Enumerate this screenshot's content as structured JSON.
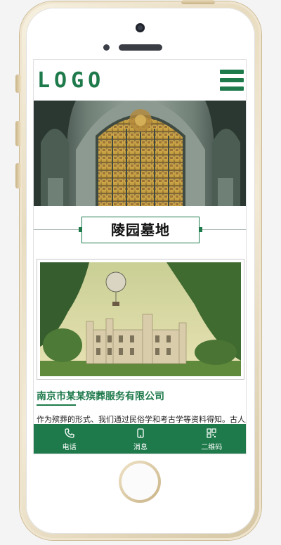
{
  "header": {
    "logo_text": "LOGO",
    "menu_icon": "hamburger-icon"
  },
  "banner": {
    "description": "cathedral-interior-image"
  },
  "section": {
    "title": "陵园墓地"
  },
  "feature": {
    "image": "castle-landscape-painting"
  },
  "company": {
    "name": "南京市某某殡葬服务有限公司",
    "description": "作为殡葬的形式、我们通过民俗学和考古学等资料得知。古人从"
  },
  "bottom_nav": {
    "items": [
      {
        "label": "电话",
        "icon": "phone-icon"
      },
      {
        "label": "消息",
        "icon": "message-icon"
      },
      {
        "label": "二维码",
        "icon": "qrcode-icon"
      }
    ]
  },
  "colors": {
    "brand": "#1e7a4b",
    "frame": "#e8dcc0"
  }
}
